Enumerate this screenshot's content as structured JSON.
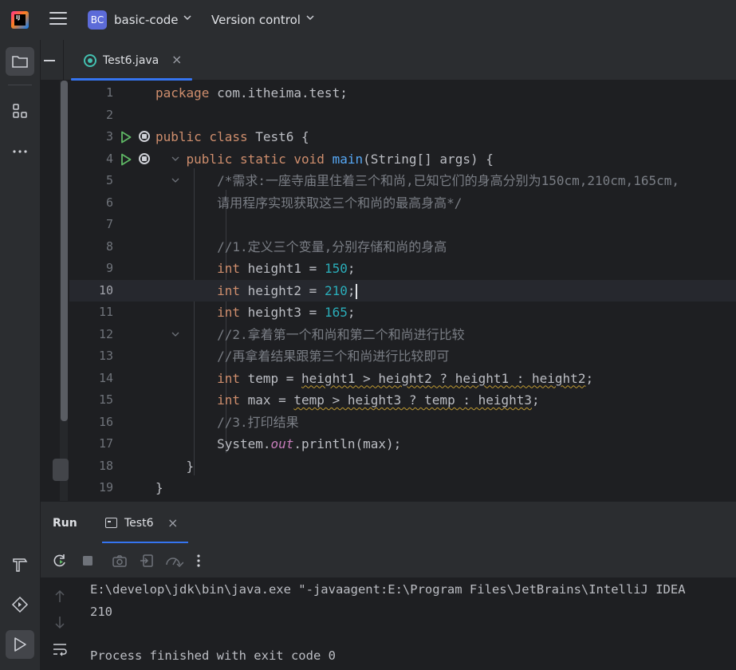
{
  "titlebar": {
    "project_badge": "BC",
    "project_name": "basic-code",
    "vcs_label": "Version control"
  },
  "tabs": [
    {
      "label": "Test6.java",
      "active": true
    }
  ],
  "editor": {
    "current_line": 10,
    "lines": [
      {
        "n": "1"
      },
      {
        "n": "2"
      },
      {
        "n": "3"
      },
      {
        "n": "4"
      },
      {
        "n": "5"
      },
      {
        "n": "6"
      },
      {
        "n": "7"
      },
      {
        "n": "8"
      },
      {
        "n": "9"
      },
      {
        "n": "10"
      },
      {
        "n": "11"
      },
      {
        "n": "12"
      },
      {
        "n": "13"
      },
      {
        "n": "14"
      },
      {
        "n": "15"
      },
      {
        "n": "16"
      },
      {
        "n": "17"
      },
      {
        "n": "18"
      },
      {
        "n": "19"
      }
    ],
    "code": {
      "l1_kw": "package",
      "l1_rest": " com.itheima.test;",
      "l3_kw": "public class",
      "l3_rest": " Test6 {",
      "l4_kw": "public static void",
      "l4_fn": "main",
      "l4_rest": "(String[] args) {",
      "l5": "/*需求:一座寺庙里住着三个和尚,已知它们的身高分别为150cm,210cm,165cm,",
      "l6": "请用程序实现获取这三个和尚的最高身高*/",
      "l8": "//1.定义三个变量,分别存储和尚的身高",
      "l9_kw": "int",
      "l9_rest": " height1 = ",
      "l9_num": "150",
      "l10_kw": "int",
      "l10_rest": " height2 = ",
      "l10_num": "210",
      "l11_kw": "int",
      "l11_rest": " height3 = ",
      "l11_num": "165",
      "semi": ";",
      "l12": "//2.拿着第一个和尚和第二个和尚进行比较",
      "l13": "//再拿着结果跟第三个和尚进行比较即可",
      "l14_kw": "int",
      "l14_a": " temp = ",
      "l14_warn": "height1 > height2 ? height1 : height2",
      "l15_kw": "int",
      "l15_a": " max = ",
      "l15_warn": "temp > height3 ? temp : height3",
      "l16": "//3.打印结果",
      "l17_a": "System.",
      "l17_sf": "out",
      "l17_b": ".println(max);",
      "l18": "}",
      "l19": "}"
    }
  },
  "run_panel": {
    "title": "Run",
    "tab_label": "Test6",
    "console": [
      "E:\\develop\\jdk\\bin\\java.exe \"-javaagent:E:\\Program Files\\JetBrains\\IntelliJ IDEA",
      "210",
      "",
      "Process finished with exit code 0"
    ]
  },
  "colors": {
    "accent": "#3574f0",
    "keyword": "#cf8e6d",
    "number": "#2aacb8",
    "comment": "#7a7e85",
    "function": "#56a8f5",
    "static_field": "#c77dbb",
    "run_green": "#5fb865"
  },
  "icons": {
    "leftstrip": [
      "folder-icon",
      "structure-icon",
      "more-icon",
      "build-icon",
      "services-icon",
      "run-icon"
    ],
    "run_toolbar": [
      "rerun-icon",
      "stop-icon",
      "screenshot-icon",
      "exit-icon",
      "dump-icon",
      "more-vertical-icon"
    ]
  }
}
